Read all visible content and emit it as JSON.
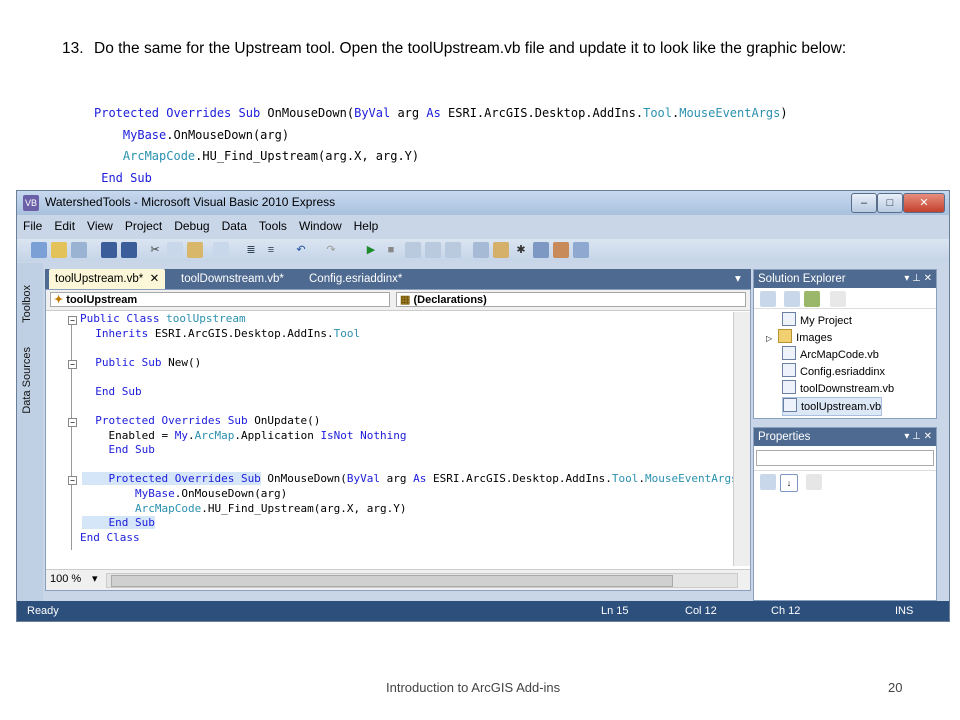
{
  "step": {
    "number": "13.",
    "text": "Do the same for the Upstream tool.  Open the toolUpstream.vb file and update it to look like the graphic below:"
  },
  "snippet": {
    "line1_kw": "Protected Overrides Sub",
    "line1_name": " OnMouseDown(",
    "line1_byval": "ByVal",
    "line1_arg": " arg ",
    "line1_as": "As",
    "line1_ns": " ESRI.ArcGIS.Desktop.AddIns.",
    "line1_tool": "Tool",
    "line1_dot": ".",
    "line1_mea": "MouseEventArgs",
    "line1_end": ")",
    "line2_kw": "MyBase",
    "line2_rest": ".OnMouseDown(arg)",
    "line3_ty": "ArcMapCode",
    "line3_rest": ".HU_Find_Upstream(arg.X, arg.Y)",
    "line4": "End Sub"
  },
  "ide": {
    "title": "WatershedTools - Microsoft Visual Basic 2010 Express",
    "app_icon": "VB",
    "window_controls": [
      "–",
      "□",
      "✕"
    ],
    "menu": [
      "File",
      "Edit",
      "View",
      "Project",
      "Debug",
      "Data",
      "Tools",
      "Window",
      "Help"
    ],
    "left_tabs": [
      "Toolbox",
      "Data Sources"
    ],
    "doc_tabs": [
      {
        "label": "toolUpstream.vb*",
        "close": "✕"
      },
      {
        "label": "toolDownstream.vb*"
      },
      {
        "label": "Config.esriaddinx*"
      }
    ],
    "tab_dropdown": "▾",
    "nav_left": "toolUpstream",
    "nav_right": "(Declarations)",
    "code": [
      {
        "a": "Public Class ",
        "b": "toolUpstream",
        "c": ""
      },
      {
        "a": "  Inherits ",
        "b": "",
        "c": "ESRI.ArcGIS.Desktop.AddIns.",
        "d": "Tool"
      },
      {
        "a": "  Public Sub ",
        "b": "",
        "c": "New()"
      },
      {
        "a": "  End Sub"
      },
      {
        "a": "  Protected Overrides Sub ",
        "c": "OnUpdate()"
      },
      {
        "c": "    Enabled = ",
        "a": "My",
        "d": "ArcMap",
        "e": ".Application ",
        "f": "IsNot Nothing"
      },
      {
        "a": "    End Sub"
      },
      {
        "a": "    Protected Overrides Sub",
        "c": " OnMouseDown(",
        "f": "ByVal",
        "g": " arg ",
        "h": "As",
        "i": " ESRI.ArcGIS.Desktop.AddIns.",
        "d": "Tool",
        "j": ".",
        "k": "MouseEventArgs",
        "l": ")"
      },
      {
        "a": "        MyBase",
        "c": ".OnMouseDown(arg)"
      },
      {
        "d": "        ArcMapCode",
        "c": ".HU_Find_Upstream(arg.X, arg.Y)"
      },
      {
        "a": "    End Sub"
      },
      {
        "a": "End Class"
      }
    ],
    "zoom": "100 %",
    "solution_explorer": {
      "title": "Solution Explorer",
      "items": [
        "My Project",
        "Images",
        "ArcMapCode.vb",
        "Config.esriaddinx",
        "toolDownstream.vb",
        "toolUpstream.vb"
      ]
    },
    "properties": {
      "title": "Properties"
    },
    "panel_controls": "▾ ⊥ ✕",
    "status": {
      "ready": "Ready",
      "ln": "Ln 15",
      "col": "Col 12",
      "ch": "Ch 12",
      "ins": "INS"
    }
  },
  "footer": {
    "title": "Introduction to ArcGIS Add-ins",
    "page": "20"
  },
  "colors": {
    "keyword": "#1c1cdc",
    "type": "#2b91af",
    "tab_bar": "#4e6a90",
    "status_bar": "#2d4f7c"
  }
}
